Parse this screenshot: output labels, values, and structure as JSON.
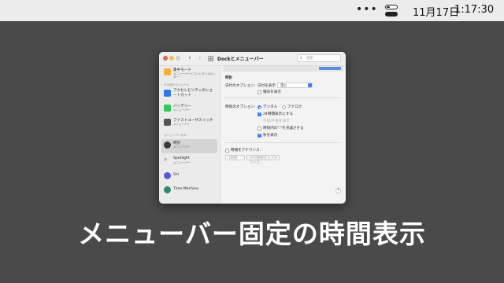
{
  "menubar": {
    "more_icon": "ellipsis-icon",
    "control_center_icon": "control-center-icon",
    "date": "11月17日",
    "time": "1:17:30"
  },
  "window": {
    "title": "Dockとメニューバー",
    "search_placeholder": "検索",
    "search_icon": "magnifier-icon"
  },
  "sidebar": {
    "items": [
      {
        "title": "集中モード",
        "subtitle": "メニューバーとコントロールセンター",
        "icon": "focus-moon-icon",
        "color": "#f4b13c"
      },
      {
        "title": "アクセシビリティのショートカット",
        "subtitle": "",
        "icon": "accessibility-icon",
        "color": "#2f7ae5"
      },
      {
        "title": "バッテリー",
        "subtitle": "メニューバー",
        "icon": "battery-icon",
        "color": "#34c759"
      },
      {
        "title": "ファストユーザスイッチ",
        "subtitle": "メニューバー",
        "icon": "user-switch-icon",
        "color": "#555555"
      },
      {
        "title": "時計",
        "subtitle": "メニューバー",
        "icon": "clock-icon",
        "color": "#3a3a3a"
      },
      {
        "title": "Spotlight",
        "subtitle": "メニューバー",
        "icon": "spotlight-icon",
        "color": "#888888"
      },
      {
        "title": "Siri",
        "subtitle": "",
        "icon": "siri-icon",
        "color": "#5a5ad6"
      },
      {
        "title": "Time Machine",
        "subtitle": "",
        "icon": "time-machine-icon",
        "color": "#2f8a6a"
      }
    ],
    "section_other": "その他のモジュール",
    "section_menubar_only": "メニューバーのみ",
    "selected_index": 4
  },
  "pane": {
    "section_title": "時計",
    "date_options_label": "日付のオプション:",
    "show_date_label": "日付を表示",
    "show_date_value": "常に",
    "show_weekday": "曜日を表示",
    "time_options_label": "時刻のオプション:",
    "digital": "デジタル",
    "analog": "アナログ",
    "use_24h": "24時間表示にする",
    "show_ampm": "午前/午後を表示",
    "flash_separator": "時刻内の\":\"を点滅させる",
    "show_seconds": "秒を表示",
    "announce_time": "時報をアナウンス:",
    "interval_value": "1時間",
    "voice_button": "声の種類をカスタマイズ...",
    "help": "?"
  },
  "caption": "メニューバー固定の時間表示"
}
